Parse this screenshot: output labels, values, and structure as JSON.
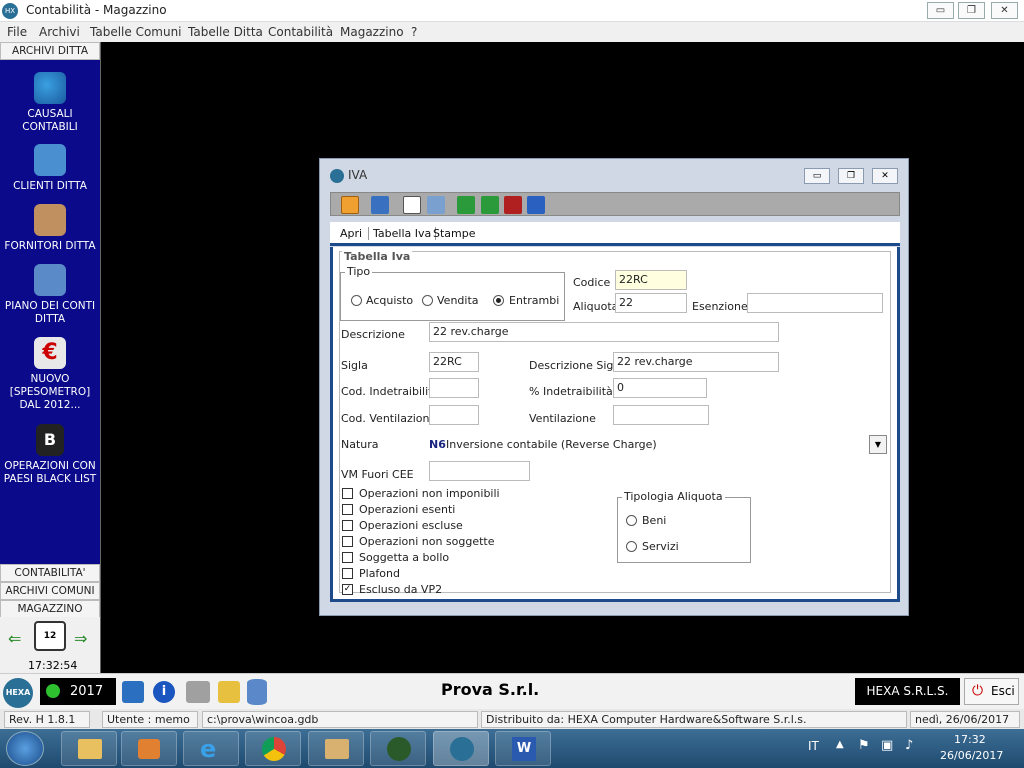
{
  "window": {
    "title": "Contabilità - Magazzino",
    "min_label": "▭",
    "max_label": "❐",
    "close_label": "✕"
  },
  "menu": [
    "File",
    "Archivi",
    "Tabelle Comuni",
    "Tabelle Ditta",
    "Contabilità",
    "Magazzino",
    "?"
  ],
  "sidebar": {
    "header": "ARCHIVI DITTA",
    "items": [
      {
        "label": "CAUSALI CONTABILI",
        "icon": "causali-icon"
      },
      {
        "label": "CLIENTI DITTA",
        "icon": "clienti-icon"
      },
      {
        "label": "FORNITORI DITTA",
        "icon": "fornitori-icon"
      },
      {
        "label": "PIANO DEI CONTI DITTA",
        "icon": "piano-conti-icon"
      },
      {
        "label": "NUOVO [SPESOMETRO] DAL 2012...",
        "icon": "spesometro-icon"
      },
      {
        "label": "OPERAZIONI CON PAESI BLACK LIST",
        "icon": "black-list-icon"
      }
    ],
    "sections": [
      "CONTABILITA'",
      "ARCHIVI COMUNI",
      "MAGAZZINO"
    ],
    "clock": "17:32:54"
  },
  "child": {
    "title": "IVA",
    "tabs": [
      "Apri",
      "Tabella Iva",
      "Stampe"
    ],
    "form": {
      "group_title": "Tabella Iva",
      "tipo_label": "Tipo",
      "tipo_options": [
        "Acquisto",
        "Vendita",
        "Entrambi"
      ],
      "tipo_selected": "Entrambi",
      "codice_label": "Codice",
      "codice_value": "22RC",
      "aliquota_label": "Aliquota",
      "aliquota_value": "22",
      "esenzione_label": "Esenzione",
      "esenzione_value": "",
      "descrizione_label": "Descrizione",
      "descrizione_value": "22 rev.charge",
      "sigla_label": "Sigla",
      "sigla_value": "22RC",
      "desc_sigla_label": "Descrizione Sigla",
      "desc_sigla_value": "22 rev.charge",
      "cod_indetr_label": "Cod. Indetraibilità",
      "cod_indetr_value": "",
      "perc_indetr_label": "% Indetraibilità",
      "perc_indetr_value": "0",
      "cod_vent_label": "Cod. Ventilazione",
      "cod_vent_value": "",
      "vent_label": "Ventilazione",
      "vent_value": "",
      "natura_label": "Natura",
      "natura_code": "N6",
      "natura_desc": "Inversione contabile (Reverse Charge)",
      "vm_label": "VM Fuori CEE",
      "vm_value": "",
      "checks": [
        {
          "label": "Operazioni non imponibili",
          "checked": false
        },
        {
          "label": "Operazioni esenti",
          "checked": false
        },
        {
          "label": "Operazioni escluse",
          "checked": false
        },
        {
          "label": "Operazioni non soggette",
          "checked": false
        },
        {
          "label": "Soggetta a bollo",
          "checked": false
        },
        {
          "label": "Plafond",
          "checked": false
        },
        {
          "label": "Escluso da VP2",
          "checked": true
        }
      ],
      "tipologia_label": "Tipologia Aliquota",
      "tipologia_options": [
        "Beni",
        "Servizi"
      ]
    }
  },
  "bottom": {
    "year": "2017",
    "company": "Prova S.r.l.",
    "vendor": "HEXA S.R.L.S.",
    "exit_label": "Esci"
  },
  "status": {
    "rev": "Rev. H 1.8.1",
    "user": "Utente : memo",
    "path": "c:\\prova\\wincoa.gdb",
    "distrib": "Distribuito da:  HEXA Computer Hardware&Software S.r.l.s.",
    "date": "nedì, 26/06/2017"
  },
  "taskbar": {
    "lang": "IT",
    "time": "17:32",
    "date": "26/06/2017"
  },
  "colors": {
    "sidebar": "#0a0a8a",
    "accent": "#1c4a8a",
    "codice_bg": "#ffffe0"
  }
}
